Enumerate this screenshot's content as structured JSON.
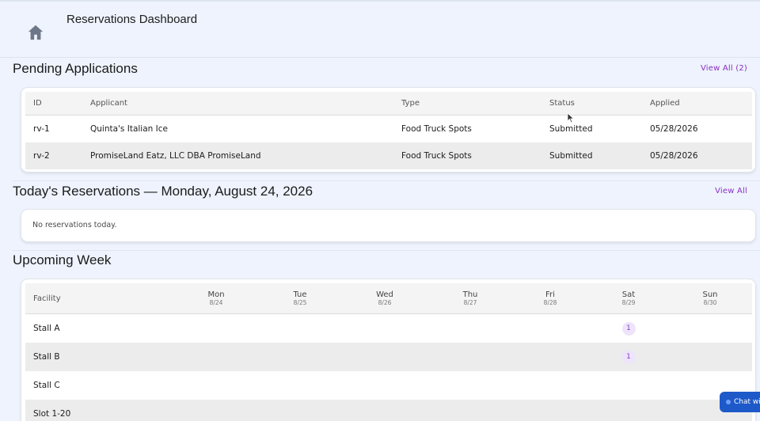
{
  "header": {
    "title": "Reservations Dashboard",
    "home_icon": "home-icon"
  },
  "pending": {
    "title": "Pending Applications",
    "view_all": "View All (2)",
    "columns": {
      "id": "ID",
      "applicant": "Applicant",
      "type": "Type",
      "status": "Status",
      "applied": "Applied"
    },
    "rows": [
      {
        "id": "rv-1",
        "applicant": "Quinta's Italian Ice",
        "type": "Food Truck Spots",
        "status": "Submitted",
        "applied": "05/28/2026"
      },
      {
        "id": "rv-2",
        "applicant": "PromiseLand Eatz, LLC DBA PromiseLand",
        "type": "Food Truck Spots",
        "status": "Submitted",
        "applied": "05/28/2026"
      }
    ]
  },
  "today": {
    "title": "Today's Reservations — Monday, August 24, 2026",
    "view_all": "View All",
    "empty": "No reservations today."
  },
  "week": {
    "title": "Upcoming Week",
    "facility_label": "Facility",
    "days": [
      {
        "name": "Mon",
        "date": "8/24"
      },
      {
        "name": "Tue",
        "date": "8/25"
      },
      {
        "name": "Wed",
        "date": "8/26"
      },
      {
        "name": "Thu",
        "date": "8/27"
      },
      {
        "name": "Fri",
        "date": "8/28"
      },
      {
        "name": "Sat",
        "date": "8/29"
      },
      {
        "name": "Sun",
        "date": "8/30"
      }
    ],
    "rows": [
      {
        "name": "Stall A",
        "counts": [
          "",
          "",
          "",
          "",
          "",
          "1",
          ""
        ]
      },
      {
        "name": "Stall B",
        "counts": [
          "",
          "",
          "",
          "",
          "",
          "1",
          ""
        ]
      },
      {
        "name": "Stall C",
        "counts": [
          "",
          "",
          "",
          "",
          "",
          "",
          ""
        ]
      },
      {
        "name": "Slot 1-20",
        "counts": [
          "",
          "",
          "",
          "",
          "",
          "",
          ""
        ]
      }
    ]
  },
  "chat": {
    "label": "Chat wit"
  },
  "colors": {
    "accent": "#8a2fc2",
    "chat": "#1e59c9",
    "link": "#3d6aa6",
    "background": "#eef3fd"
  }
}
